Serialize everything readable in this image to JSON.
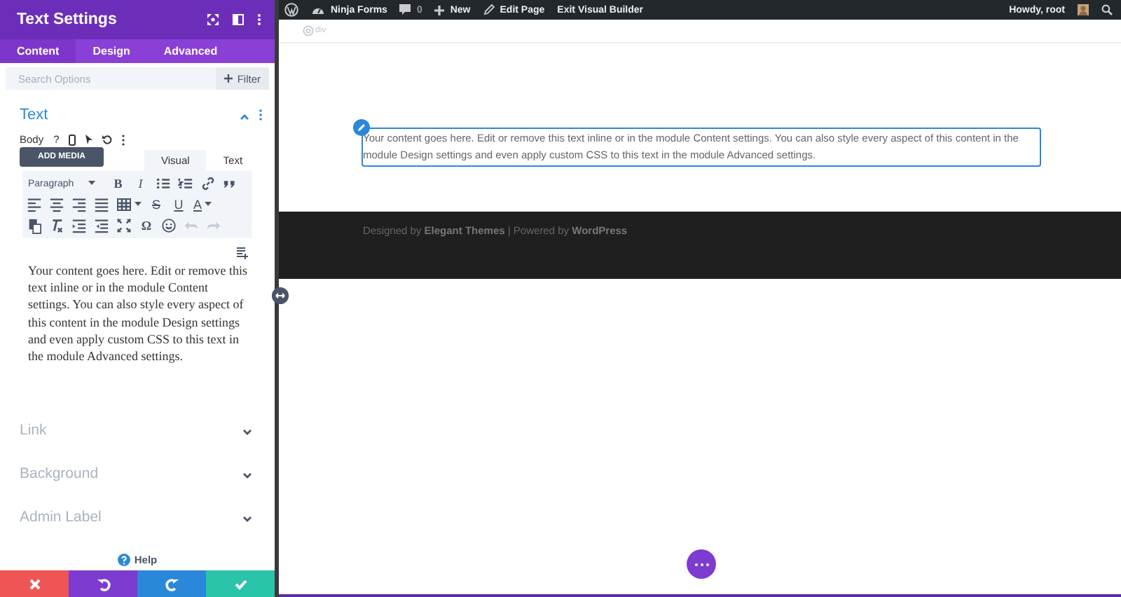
{
  "panel": {
    "title": "Text Settings",
    "tabs": [
      {
        "label": "Content",
        "selected": true
      },
      {
        "label": "Design",
        "selected": false
      },
      {
        "label": "Advanced",
        "selected": false
      }
    ],
    "search": {
      "placeholder": "Search Options"
    },
    "filter": "Filter",
    "section": {
      "title": "Text",
      "expanded": true
    },
    "body_label": "Body",
    "help_mark": "?",
    "add_media": "ADD MEDIA",
    "editor_tabs": [
      {
        "label": "Visual",
        "selected": true
      },
      {
        "label": "Text",
        "selected": false
      }
    ],
    "toolbar": [
      [
        {
          "kind": "select",
          "label": "Paragraph"
        },
        {
          "kind": "letter",
          "glyph": "B"
        },
        {
          "kind": "italic",
          "glyph": "I"
        },
        {
          "kind": "bullets"
        },
        {
          "kind": "numbers"
        },
        {
          "kind": "link"
        },
        {
          "kind": "quote"
        }
      ],
      [
        {
          "kind": "align-left"
        },
        {
          "kind": "align-center"
        },
        {
          "kind": "align-right"
        },
        {
          "kind": "justify"
        },
        {
          "kind": "table"
        },
        {
          "kind": "strike",
          "glyph": "S"
        },
        {
          "kind": "underline",
          "glyph": "U"
        },
        {
          "kind": "color",
          "glyph": "A"
        }
      ],
      [
        {
          "kind": "paste"
        },
        {
          "kind": "clear"
        },
        {
          "kind": "outdent"
        },
        {
          "kind": "indent"
        },
        {
          "kind": "fullscreen"
        },
        {
          "kind": "letter",
          "glyph": "Ω"
        },
        {
          "kind": "emoji"
        },
        {
          "kind": "undo"
        },
        {
          "kind": "redo"
        }
      ]
    ],
    "content": "Your content goes here. Edit or remove this text inline or in the module Content settings. You can also style every aspect of this content in the module Design settings and even apply custom CSS to this text in the module Advanced settings.",
    "groups": [
      {
        "title": "Link",
        "expanded": false
      },
      {
        "title": "Background",
        "expanded": false
      },
      {
        "title": "Admin Label",
        "expanded": false
      }
    ],
    "help": "Help",
    "actions": [
      {
        "kind": "cancel",
        "color": "#ef5555"
      },
      {
        "kind": "undo",
        "color": "#7e3bd0"
      },
      {
        "kind": "redo",
        "color": "#2b87da"
      },
      {
        "kind": "save",
        "color": "#29c4a9"
      }
    ]
  },
  "admin_bar": {
    "items": [
      {
        "kind": "wp-logo"
      },
      {
        "kind": "site",
        "label": "Ninja Forms"
      },
      {
        "kind": "comments",
        "label": "0"
      },
      {
        "kind": "new",
        "label": "New"
      },
      {
        "kind": "edit",
        "label": "Edit Page"
      },
      {
        "kind": "plain",
        "label": "Exit Visual Builder"
      }
    ],
    "greeting": "Howdy, root"
  },
  "breadcrumb": "div",
  "module_text": "Your content goes here. Edit or remove this text inline or in the module Content settings. You can also style every aspect of this content in the module Design settings and even apply custom CSS to this text in the module Advanced settings.",
  "footer": "Designed by **Elegant Themes** | Powered by **WordPress**"
}
